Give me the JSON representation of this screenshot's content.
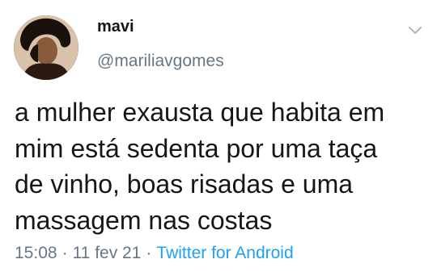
{
  "tweet": {
    "display_name": "mavi",
    "handle": "@mariliavgomes",
    "text_lines": [
      "a mulher exausta que habita em",
      "mim está sedenta por uma taça",
      "de vinho, boas risadas e uma",
      "massagem nas costas"
    ],
    "time": "15:08",
    "date": "11 fev 21",
    "separator": "·",
    "source": "Twitter for Android"
  },
  "icons": {
    "avatar": "profile-photo",
    "menu": "chevron-down-icon"
  },
  "colors": {
    "text": "#14171a",
    "secondary": "#657786",
    "link": "#1da1f2",
    "background": "#ffffff"
  }
}
